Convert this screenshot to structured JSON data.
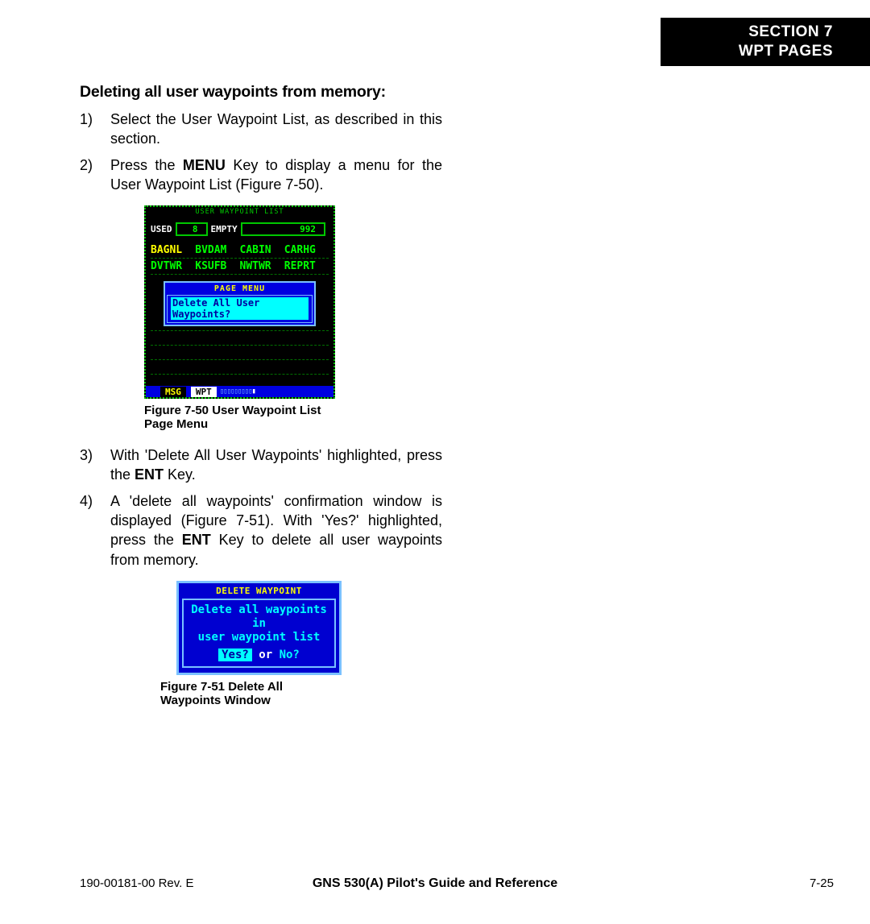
{
  "header": {
    "line1": "SECTION 7",
    "line2": "WPT PAGES"
  },
  "subheading": "Deleting all user waypoints from memory:",
  "steps": [
    {
      "num": "1)",
      "pre": "Select the User Waypoint List, as described in this section."
    },
    {
      "num": "2)",
      "pre": "Press the ",
      "bold": "MENU",
      "post": " Key to display a menu for the User Waypoint List (Figure 7-50)."
    },
    {
      "num": "3)",
      "pre": "With 'Delete All User Waypoints' highlighted, press the ",
      "bold": "ENT",
      "post": " Key."
    },
    {
      "num": "4)",
      "pre": "A 'delete all waypoints' confirmation window is displayed (Figure 7-51).  With 'Yes?' highlighted, press the ",
      "bold": "ENT",
      "post": " Key to delete all user waypoints from memory."
    }
  ],
  "fig50": {
    "caption": "Figure 7-50  User Waypoint List Page Menu",
    "screen_title": "USER WAYPOINT LIST",
    "used_label": "USED",
    "used_value": "8",
    "empty_label": "EMPTY",
    "empty_value": "992",
    "waypoints_row1": [
      "BAGNL",
      "BVDAM",
      "CABIN",
      "CARHG"
    ],
    "waypoints_row2": [
      "DVTWR",
      "KSUFB",
      "NWTWR",
      "REPRT"
    ],
    "menu_title": "PAGE MENU",
    "menu_item": "Delete All User Waypoints?",
    "footer_msg": "MSG",
    "footer_wpt": "WPT"
  },
  "fig51": {
    "caption": "Figure 7-51  Delete All Waypoints Window",
    "title": "DELETE WAYPOINT",
    "line1": "Delete all waypoints in",
    "line2": "user waypoint list",
    "yes": "Yes?",
    "or": "or",
    "no": "No?"
  },
  "footer": {
    "left": "190-00181-00  Rev. E",
    "center": "GNS 530(A) Pilot's Guide and Reference",
    "right": "7-25"
  }
}
